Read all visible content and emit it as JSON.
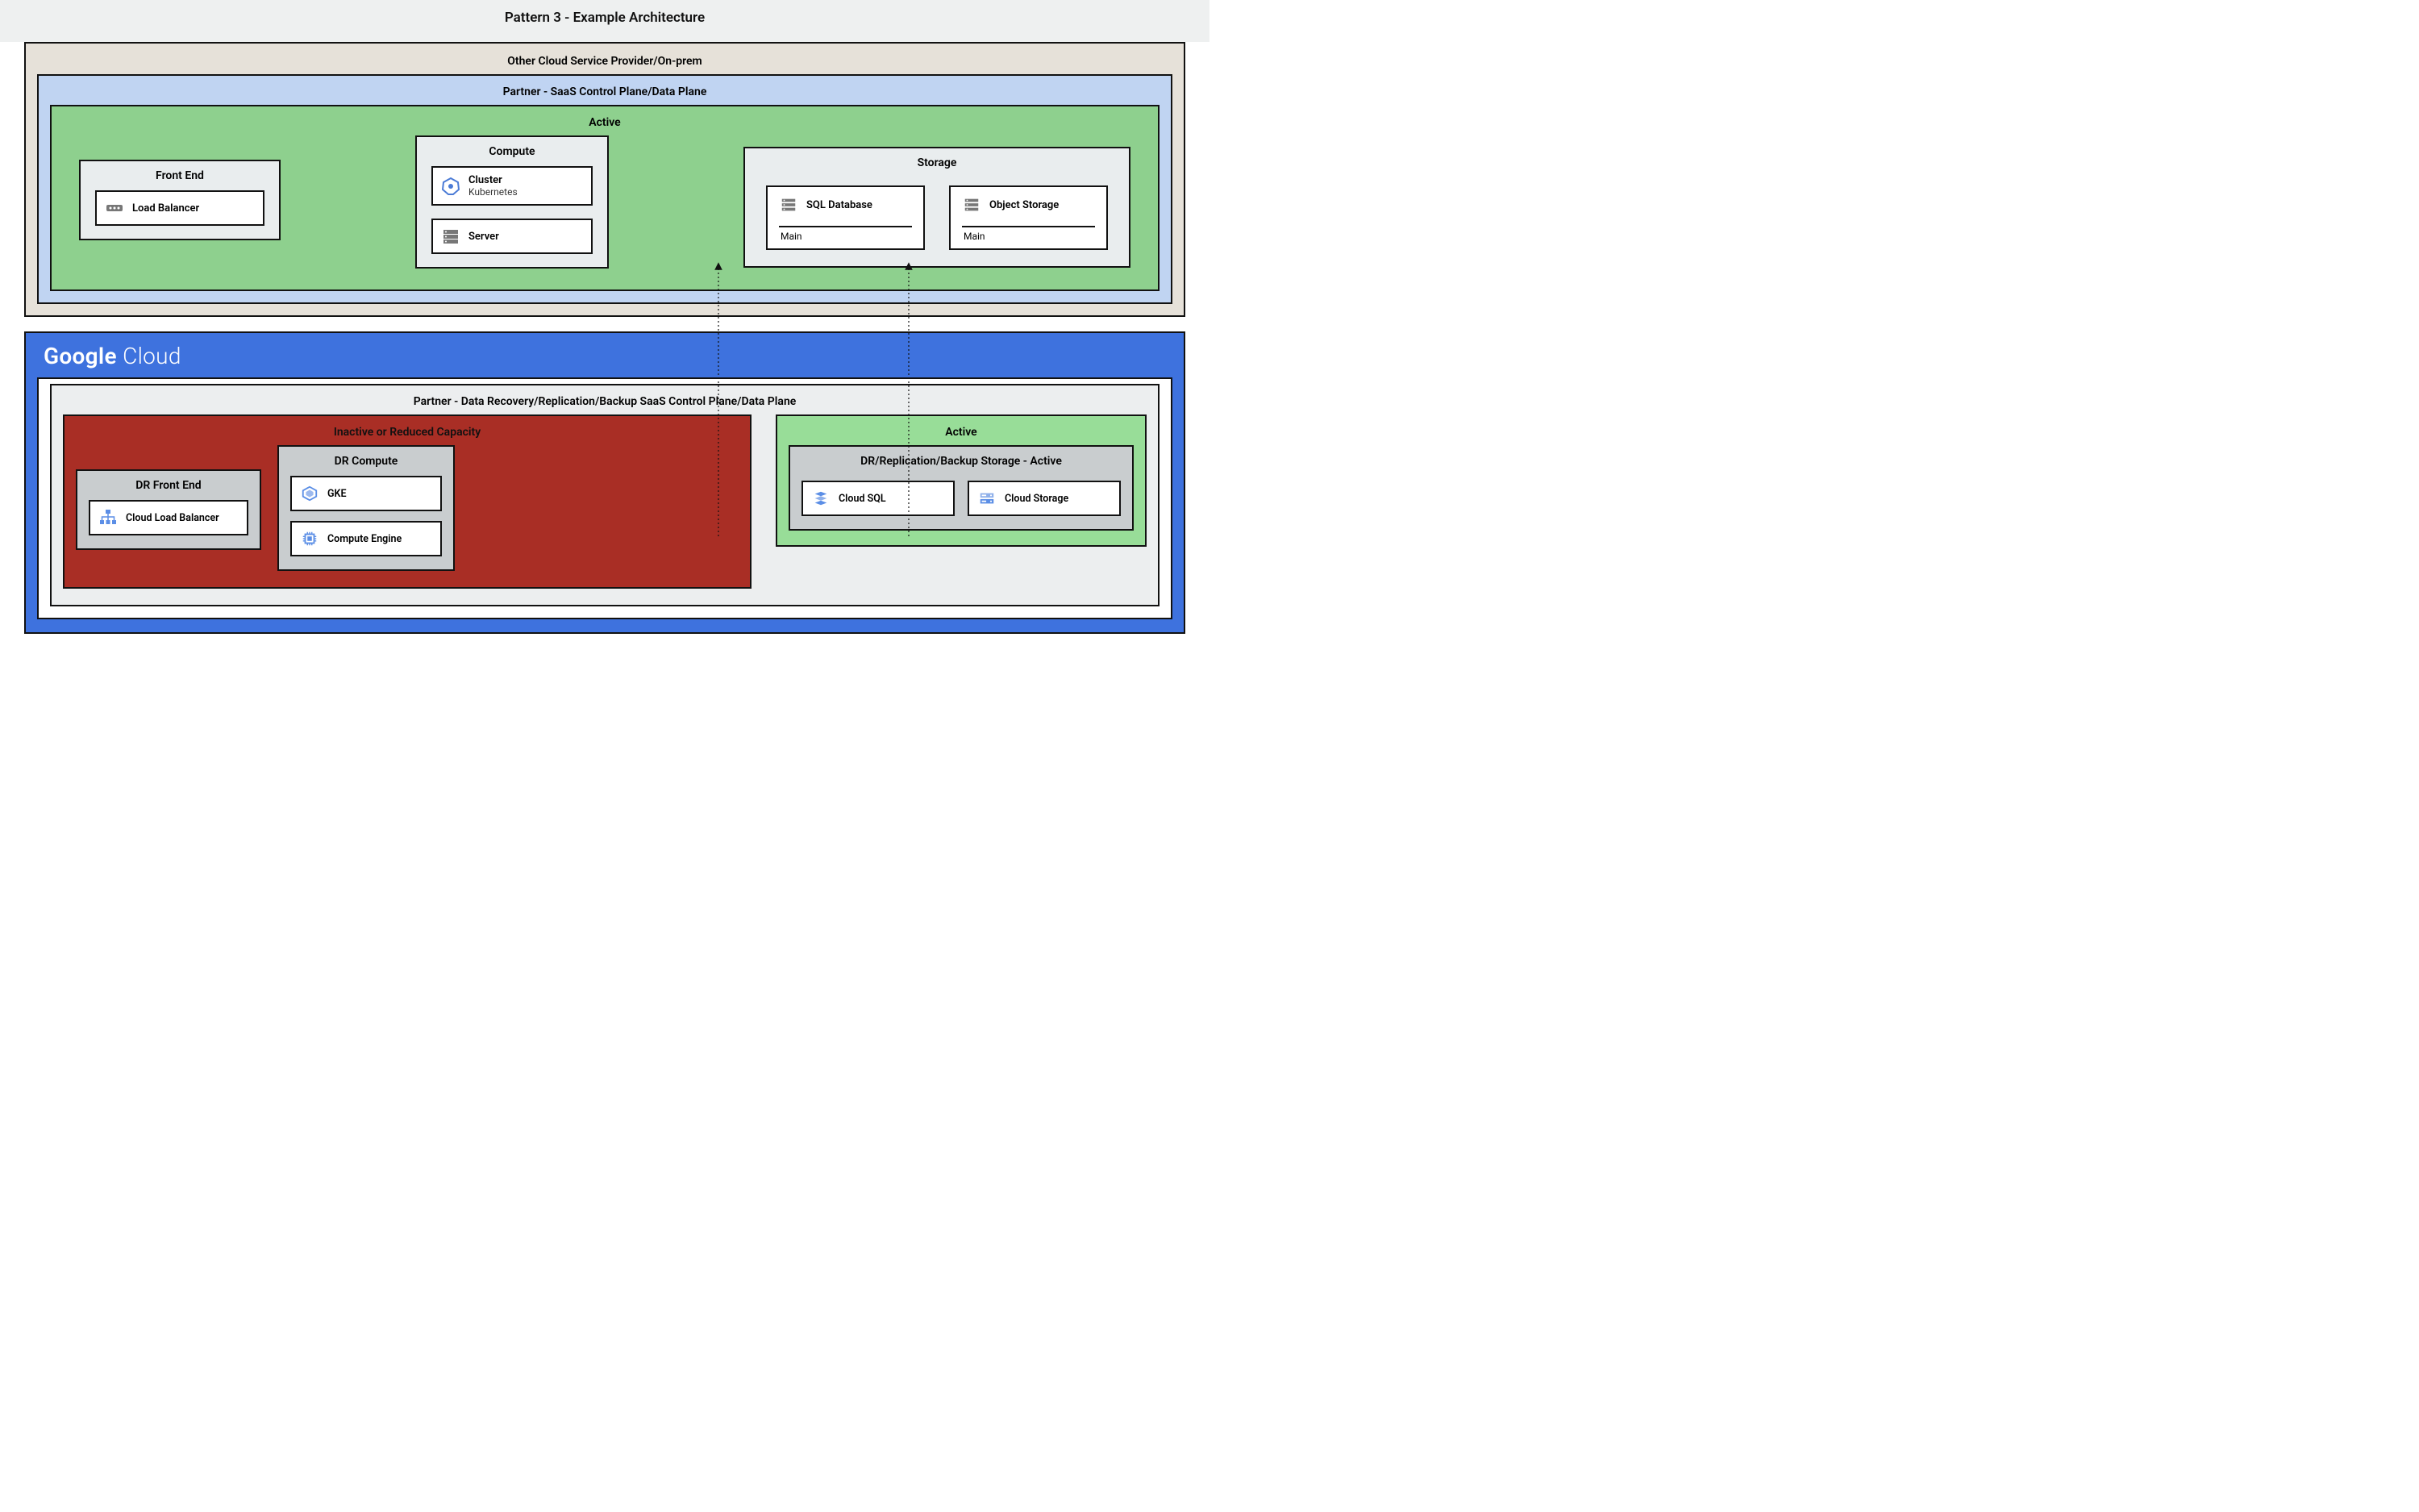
{
  "title": "Pattern 3 - Example Architecture",
  "top": {
    "outer_label": "Other Cloud Service Provider/On-prem",
    "partner_label": "Partner - SaaS Control Plane/Data Plane",
    "active_label": "Active",
    "frontend": {
      "title": "Front End",
      "item": "Load Balancer"
    },
    "compute": {
      "title": "Compute",
      "cluster": {
        "title": "Cluster",
        "sub": "Kubernetes"
      },
      "server": {
        "title": "Server"
      }
    },
    "storage": {
      "title": "Storage",
      "sql": {
        "title": "SQL Database",
        "foot": "Main"
      },
      "obj": {
        "title": "Object Storage",
        "foot": "Main"
      }
    }
  },
  "bottom": {
    "logo_a": "Google",
    "logo_b": "Cloud",
    "partner_label": "Partner - Data Recovery/Replication/Backup SaaS Control Plane/Data Plane",
    "red_label": "Inactive or Reduced Capacity",
    "dr_frontend": {
      "title": "DR Front End",
      "item": "Cloud Load Balancer"
    },
    "dr_compute": {
      "title": "DR Compute",
      "gke": "GKE",
      "ce": "Compute Engine"
    },
    "active_label": "Active",
    "storage": {
      "title": "DR/Replication/Backup Storage - Active",
      "sql": "Cloud SQL",
      "obj": "Cloud Storage"
    }
  }
}
